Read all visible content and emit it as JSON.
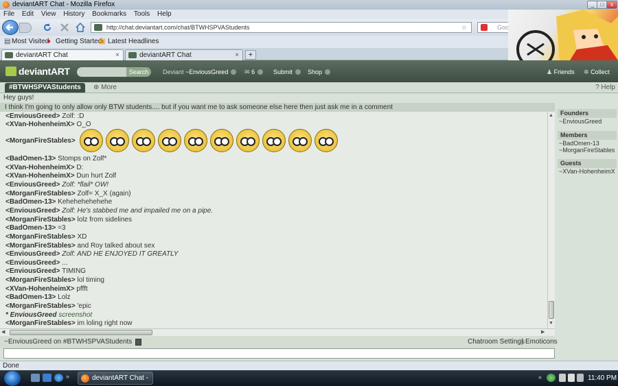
{
  "window": {
    "title": "deviantART Chat - Mozilla Firefox"
  },
  "menu": [
    "File",
    "Edit",
    "View",
    "History",
    "Bookmarks",
    "Tools",
    "Help"
  ],
  "address": {
    "url": "http://chat.deviantart.com/chat/BTWHSPVAStudents",
    "search_placeholder": "Google"
  },
  "bookmarks": [
    "Most Visited",
    "Getting Started",
    "Latest Headlines"
  ],
  "tabs": [
    {
      "label": "deviantART Chat"
    },
    {
      "label": "deviantART Chat"
    }
  ],
  "da": {
    "logo": "deviantART",
    "search_button": "Search",
    "user": "Deviant",
    "username": "~EnviousGreed",
    "messages": "6",
    "submit": "Submit",
    "shop": "Shop",
    "friends": "Friends",
    "collect": "Collect"
  },
  "room": {
    "tab": "#BTWHSPVAStudents",
    "more": "More",
    "help": "Help",
    "greeting": "Hey guys!",
    "topic": "I think I'm going to only allow only BTW students.... but if you want me to ask someone else here then just ask me in a comment"
  },
  "chat": [
    {
      "name": "<EnviousGreed>",
      "text": "Zolf: :D"
    },
    {
      "name": "<XVan-HohenheimX>",
      "text": "O_O"
    },
    {
      "name": "<MorganFireStables>",
      "text": ""
    },
    {
      "name": "<BadOmen-13>",
      "text": "Stomps on Zolf*"
    },
    {
      "name": "<XVan-HohenheimX>",
      "text": "D:"
    },
    {
      "name": "<XVan-HohenheimX>",
      "text": "Dun hurt Zolf"
    },
    {
      "name": "<EnviousGreed>",
      "text": "Zolf: *flail* OW!"
    },
    {
      "name": "<MorganFireStables>",
      "text": "Zolf= X_X (again)"
    },
    {
      "name": "<BadOmen-13>",
      "text": "Kehehehehehehe"
    },
    {
      "name": "<EnviousGreed>",
      "text": "Zolf: He's stabbed me and impailed me on a pipe."
    },
    {
      "name": "<MorganFireStables>",
      "text": "lolz from sidelines"
    },
    {
      "name": "<BadOmen-13>",
      "text": "=3"
    },
    {
      "name": "<MorganFireStables>",
      "text": "XD"
    },
    {
      "name": "<MorganFireStables>",
      "text": "and Roy talked about sex"
    },
    {
      "name": "<EnviousGreed>",
      "text": "Zolf: AND HE ENJOYED IT GREATLY"
    },
    {
      "name": "<EnviousGreed>",
      "text": "..."
    },
    {
      "name": "<EnviousGreed>",
      "text": "TIMING"
    },
    {
      "name": "<MorganFireStables>",
      "text": "lol timing"
    },
    {
      "name": "<XVan-HohenheimX>",
      "text": "pffft"
    },
    {
      "name": "<BadOmen-13>",
      "text": "Lolz"
    },
    {
      "name": "<MorganFireStables>",
      "text": "'epic"
    },
    {
      "name": "* EnviousGreed",
      "text": "screenshot"
    },
    {
      "name": "<MorganFireStables>",
      "text": "im loling right now"
    }
  ],
  "sidebar": {
    "founders_label": "Founders",
    "founders": [
      "~EnviousGreed"
    ],
    "members_label": "Members",
    "members": [
      "~BadOmen-13",
      "~MorganFireStables"
    ],
    "guests_label": "Guests",
    "guests": [
      "~XVan-HohenheimX"
    ]
  },
  "footer": {
    "status": "~EnviousGreed on #BTWHSPVAStudents",
    "settings": "Chatroom Settings",
    "sep": "|",
    "emoticons": "Emoticons"
  },
  "browser_status": "Done",
  "taskbar": {
    "item": "deviantART Chat - ...",
    "clock": "11:40 PM"
  }
}
